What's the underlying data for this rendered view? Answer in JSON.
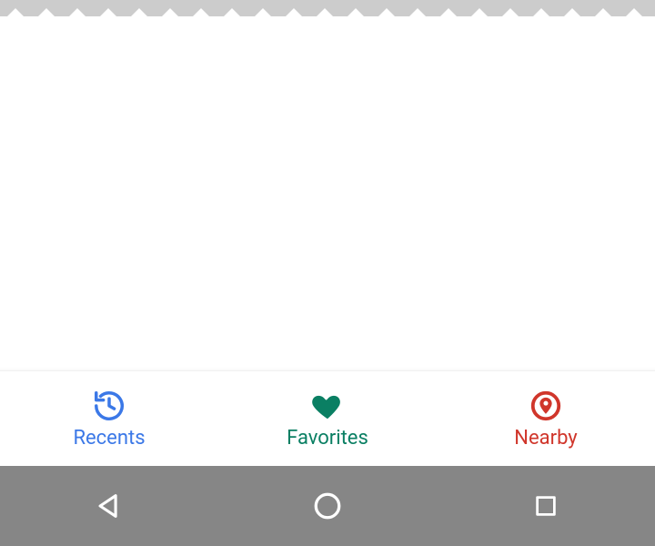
{
  "bottom_nav": {
    "items": [
      {
        "label": "Recents",
        "icon": "history-icon",
        "active": false,
        "color": "#3b78e7"
      },
      {
        "label": "Favorites",
        "icon": "heart-icon",
        "active": true,
        "color": "#0a7f63"
      },
      {
        "label": "Nearby",
        "icon": "location-icon",
        "active": false,
        "color": "#d0362b"
      }
    ]
  },
  "system_nav": {
    "buttons": [
      {
        "name": "back",
        "icon": "triangle-back-icon"
      },
      {
        "name": "home",
        "icon": "circle-home-icon"
      },
      {
        "name": "recents",
        "icon": "square-recents-icon"
      }
    ],
    "bar_color": "#868686",
    "icon_color": "#ffffff"
  }
}
